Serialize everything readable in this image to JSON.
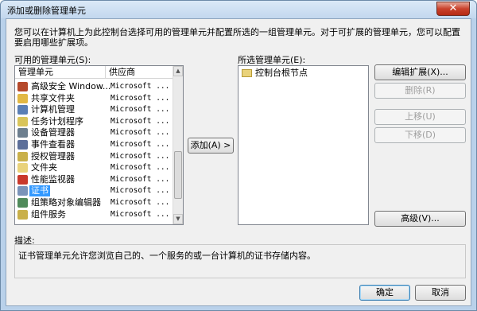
{
  "window": {
    "title": "添加或删除管理单元",
    "close_glyph": "✕"
  },
  "intro": "您可以在计算机上为此控制台选择可用的管理单元并配置所选的一组管理单元。对于可扩展的管理单元，您可以配置要启用哪些扩展项。",
  "available": {
    "label": "可用的管理单元(S):",
    "col_name": "管理单元",
    "col_vendor": "供应商",
    "items": [
      {
        "name": "高级安全 Window...",
        "vendor": "Microsoft ...",
        "icon": "firewall-icon",
        "color": "#b5492b"
      },
      {
        "name": "共享文件夹",
        "vendor": "Microsoft ...",
        "icon": "shared-folder-icon",
        "color": "#e2b844"
      },
      {
        "name": "计算机管理",
        "vendor": "Microsoft ...",
        "icon": "computer-management-icon",
        "color": "#5a7fb5"
      },
      {
        "name": "任务计划程序",
        "vendor": "Microsoft ...",
        "icon": "clock-icon",
        "color": "#d9c55a"
      },
      {
        "name": "设备管理器",
        "vendor": "Microsoft ...",
        "icon": "device-manager-icon",
        "color": "#6d7f8f"
      },
      {
        "name": "事件查看器",
        "vendor": "Microsoft ...",
        "icon": "event-viewer-icon",
        "color": "#5c6f9a"
      },
      {
        "name": "授权管理器",
        "vendor": "Microsoft ...",
        "icon": "authorization-icon",
        "color": "#c9b04a"
      },
      {
        "name": "文件夹",
        "vendor": "Microsoft ...",
        "icon": "folder-icon",
        "color": "#e9d27a"
      },
      {
        "name": "性能监视器",
        "vendor": "Microsoft ...",
        "icon": "performance-icon",
        "color": "#c9382b"
      },
      {
        "name": "证书",
        "vendor": "Microsoft ...",
        "icon": "certificate-icon",
        "color": "#7a93b9",
        "selected": true
      },
      {
        "name": "组策略对象编辑器",
        "vendor": "Microsoft ...",
        "icon": "group-policy-icon",
        "color": "#4f8a5a"
      },
      {
        "name": "组件服务",
        "vendor": "Microsoft ...",
        "icon": "component-services-icon",
        "color": "#c9b04a"
      }
    ]
  },
  "add_button": "添加(A) >",
  "selected": {
    "label": "所选管理单元(E):",
    "root": "控制台根节点"
  },
  "buttons": {
    "edit_extensions": "编辑扩展(X)...",
    "remove": "删除(R)",
    "move_up": "上移(U)",
    "move_down": "下移(D)",
    "advanced": "高级(V)...",
    "ok": "确定",
    "cancel": "取消"
  },
  "description": {
    "label": "描述:",
    "text": "证书管理单元允许您浏览自己的、一个服务的或一台计算机的证书存储内容。"
  }
}
